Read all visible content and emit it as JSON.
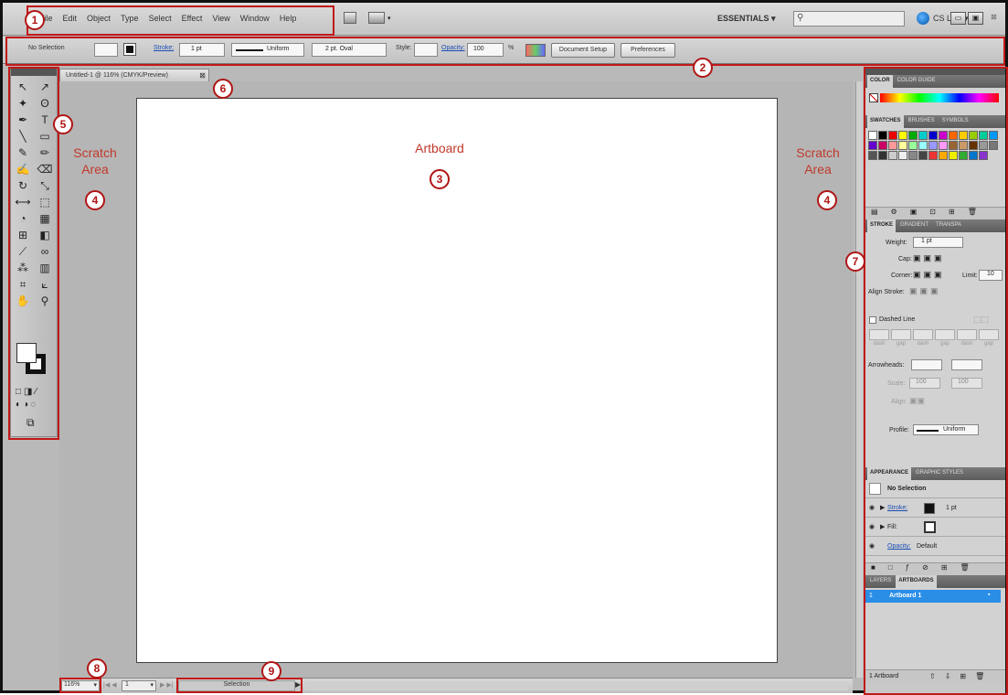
{
  "menubar": {
    "items": [
      "File",
      "Edit",
      "Object",
      "Type",
      "Select",
      "Effect",
      "View",
      "Window",
      "Help"
    ],
    "workspace": "ESSENTIALS ▾",
    "cslive": "CS Live ▾"
  },
  "control": {
    "selection": "No Selection",
    "stroke_label": "Stroke:",
    "stroke_weight": "1 pt",
    "stroke_profile": "Uniform",
    "brush": "2 pt. Oval",
    "style_label": "Style:",
    "opacity_label": "Opacity:",
    "opacity_value": "100",
    "opacity_unit": "%",
    "doc_setup": "Document Setup",
    "preferences": "Preferences"
  },
  "document": {
    "tab_title": "Untitled-1 @ 116% (CMYK/Preview)",
    "tab_close": "⊠"
  },
  "labels": {
    "artboard": "Artboard",
    "scratch_left": "Scratch\nArea",
    "scratch_right": "Scratch\nArea"
  },
  "badges": [
    "1",
    "2",
    "3",
    "4",
    "4",
    "5",
    "6",
    "7",
    "8",
    "9"
  ],
  "panels": {
    "color_tabs": [
      "COLOR",
      "COLOR GUIDE"
    ],
    "swatch_tabs": [
      "SWATCHES",
      "BRUSHES",
      "SYMBOLS"
    ],
    "stroke_tabs": [
      "STROKE",
      "GRADIENT",
      "TRANSPA"
    ],
    "stroke": {
      "weight_label": "Weight:",
      "weight_value": "1 pt",
      "cap_label": "Cap:",
      "corner_label": "Corner:",
      "limit_label": "Limit:",
      "limit_value": "10",
      "align_label": "Align Stroke:",
      "dashed_label": "Dashed Line",
      "dash_labels": [
        "dash",
        "gap",
        "dash",
        "gap",
        "dash",
        "gap"
      ],
      "arrowheads_label": "Arrowheads:",
      "scale_label": "Scale:",
      "scale_values": [
        "100",
        "100"
      ],
      "align_arrow_label": "Align:",
      "profile_label": "Profile:",
      "profile_value": "Uniform"
    },
    "appearance_tabs": [
      "APPEARANCE",
      "GRAPHIC STYLES"
    ],
    "appearance": {
      "title": "No Selection",
      "stroke_label": "Stroke:",
      "stroke_value": "1 pt",
      "fill_label": "Fill:",
      "opacity_label": "Opacity:",
      "opacity_value": "Default"
    },
    "layers_tabs": [
      "LAYERS",
      "ARTBOARDS"
    ],
    "artboard_row": {
      "index": "1",
      "name": "Artboard 1"
    },
    "footer": "1 Artboard"
  },
  "status": {
    "zoom": "116%",
    "page": "1",
    "mode": "Selection"
  },
  "colors": {
    "highlight": "#c21818",
    "link": "#1c4fb4",
    "selection_row": "#2a8ee6"
  }
}
